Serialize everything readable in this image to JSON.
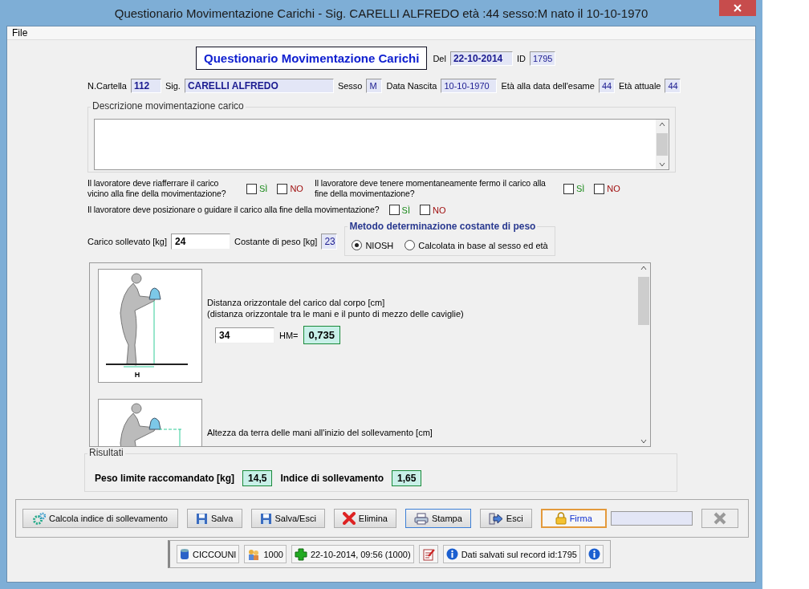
{
  "window": {
    "title": "Questionario Movimentazione Carichi - Sig. CARELLI ALFREDO età :44 sesso:M nato il 10-10-1970"
  },
  "menu": [
    "File"
  ],
  "header": {
    "title": "Questionario Movimentazione Carichi",
    "date_label": "Del",
    "date": "22-10-2014",
    "id_label": "ID",
    "id": "1795"
  },
  "patient": [
    {
      "label": "N.Cartella",
      "value": "112",
      "kind": "bold"
    },
    {
      "label": "Sig.",
      "value": "CARELLI ALFREDO",
      "kind": "bold"
    },
    {
      "label": "Sesso",
      "value": "M",
      "kind": "plain"
    },
    {
      "label": "Data Nascita",
      "value": "10-10-1970",
      "kind": "plain"
    },
    {
      "label": "Età alla data dell'esame",
      "value": "44",
      "kind": "plain"
    },
    {
      "label": "Età attuale",
      "value": "44",
      "kind": "plain"
    }
  ],
  "description": {
    "label": "Descrizione movimentazione carico"
  },
  "questions": [
    [
      {
        "text": "Il lavoratore deve riafferrare il carico vicino alla fine della movimentazione?",
        "yes": "SÌ",
        "no": "NO",
        "yes_checked": false,
        "no_checked": false
      },
      {
        "text": "Il lavoratore deve tenere momentaneamente fermo il carico alla fine della movimentazione?",
        "yes": "SÌ",
        "no": "NO",
        "yes_checked": false,
        "no_checked": false
      }
    ],
    [
      {
        "text": "Il lavoratore deve posizionare o guidare il carico alla fine della movimentazione?",
        "yes": "SÌ",
        "no": "NO",
        "yes_checked": false,
        "no_checked": false
      }
    ]
  ],
  "load": {
    "label": "Carico sollevato [kg]",
    "value": "24",
    "constant_label": "Costante di peso [kg]",
    "constant": "23"
  },
  "method": {
    "title": "Metodo determinazione costante di peso",
    "options": [
      {
        "label": "NIOSH",
        "selected": true
      },
      {
        "label": "Calcolata in base al sesso ed età",
        "selected": false
      }
    ]
  },
  "factors": [
    {
      "lines": [
        "Distanza orizzontale del carico dal corpo [cm]",
        "(distanza orizzontale tra le mani e il punto di mezzo delle caviglie)"
      ],
      "value": "34",
      "result_label": "HM=",
      "result": "0,735",
      "axis_label": "H",
      "kind": "horizontal"
    },
    {
      "lines": [
        "Altezza da terra delle mani all'inizio del sollevamento [cm]"
      ],
      "kind": "vertical"
    }
  ],
  "results": {
    "title": "Risultati",
    "items": [
      {
        "label": "Peso limite raccomandato [kg]",
        "value": "14,5"
      },
      {
        "label": "Indice di sollevamento",
        "value": "1,65"
      }
    ]
  },
  "buttons": [
    "Calcola indice di sollevamento",
    "Salva",
    "Salva/Esci",
    "Elimina",
    "Stampa",
    "Esci",
    "Firma"
  ],
  "status": [
    "CICCOUNI",
    "1000",
    "22-10-2014, 09:56 (1000)",
    "Dati salvati sul record id:1795"
  ]
}
